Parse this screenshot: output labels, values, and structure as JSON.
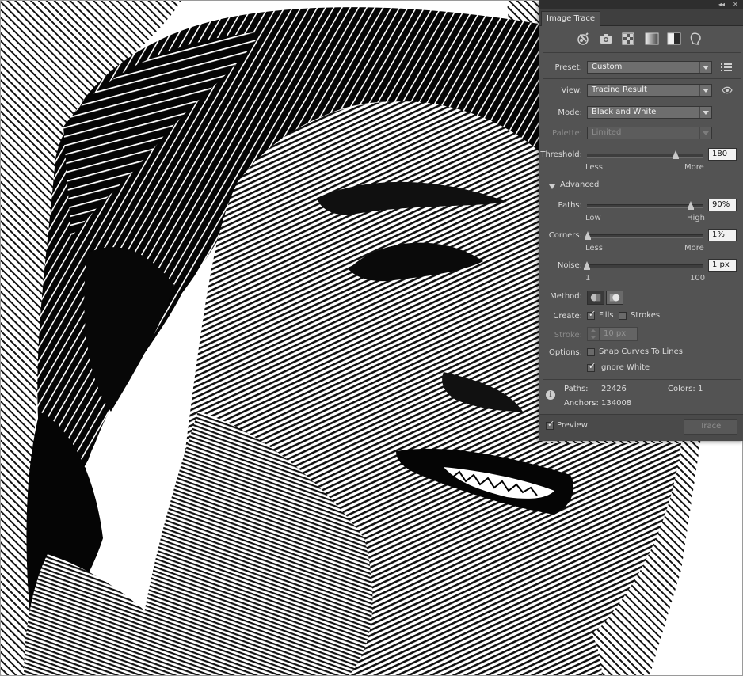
{
  "panel": {
    "title": "Image Trace",
    "collapse_glyph": "◂◂",
    "menu_glyph": "≡",
    "toolbar_icons": [
      "auto-color-icon",
      "high-color-icon",
      "low-color-icon",
      "grayscale-icon",
      "black-and-white-icon",
      "outline-icon"
    ],
    "preset": {
      "label": "Preset:",
      "value": "Custom"
    },
    "view": {
      "label": "View:",
      "value": "Tracing Result"
    },
    "mode": {
      "label": "Mode:",
      "value": "Black and White"
    },
    "palette": {
      "label": "Palette:",
      "value": "Limited"
    },
    "threshold": {
      "label": "Threshold:",
      "value": "180",
      "min_label": "Less",
      "max_label": "More",
      "level": 0.77
    },
    "advanced_label": "Advanced",
    "paths": {
      "label": "Paths:",
      "value": "90%",
      "min_label": "Low",
      "max_label": "High",
      "level": 0.9
    },
    "corners": {
      "label": "Corners:",
      "value": "1%",
      "min_label": "Less",
      "max_label": "More",
      "level": 0.01
    },
    "noise": {
      "label": "Noise:",
      "value": "1 px",
      "min_label": "1",
      "max_label": "100",
      "level": 0.0
    },
    "method_label": "Method:",
    "create": {
      "label": "Create:",
      "fills_label": "Fills",
      "strokes_label": "Strokes"
    },
    "stroke": {
      "label": "Stroke:",
      "value": "10 px"
    },
    "options": {
      "label": "Options:",
      "snap_label": "Snap Curves To Lines",
      "ignore_white_label": "Ignore White"
    },
    "stats": {
      "paths_label": "Paths:",
      "paths_value": "22426",
      "anchors_label": "Anchors:",
      "anchors_value": "134008",
      "colors_label": "Colors:",
      "colors_value": "1"
    },
    "preview_label": "Preview",
    "trace_label": "Trace"
  },
  "colors": {
    "panel_bg": "#535353",
    "field_bg": "#6e6e6e",
    "text": "#dcdcdc"
  }
}
